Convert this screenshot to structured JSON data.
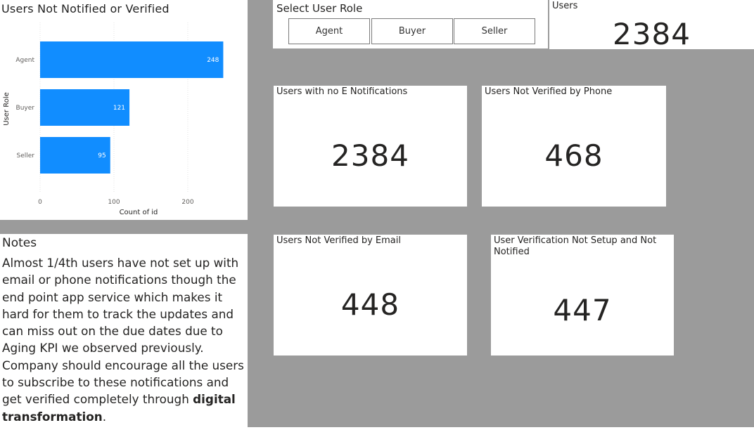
{
  "chart": {
    "title": "Users Not Notified or Verified"
  },
  "chart_data": {
    "type": "bar",
    "orientation": "horizontal",
    "categories": [
      "Agent",
      "Buyer",
      "Seller"
    ],
    "values": [
      248,
      121,
      95
    ],
    "xlabel": "Count of id",
    "ylabel": "User Role",
    "x_ticks": [
      0,
      100,
      200
    ],
    "xlim": [
      0,
      260
    ],
    "grid": true,
    "bar_color": "#118dff"
  },
  "slicer": {
    "title": "Select User Role",
    "options": [
      "Agent",
      "Buyer",
      "Seller"
    ]
  },
  "kpis": {
    "users": {
      "label": "Users",
      "value": "2384"
    },
    "no_e_notifications": {
      "label": "Users with no E Notifications",
      "value": "2384"
    },
    "not_verified_phone": {
      "label": "Users Not Verified by Phone",
      "value": "468"
    },
    "not_verified_email": {
      "label": "Users Not Verified by Email",
      "value": "448"
    },
    "not_setup_not_notified": {
      "label": "User Verification Not Setup and Not Notified",
      "value": "447"
    }
  },
  "notes": {
    "title": "Notes",
    "paragraph1": "Almost 1/4th users have not set up with email or phone notifications though the end point app service which makes it hard for them to track the updates and can miss out on the due dates due to Aging KPI we observed previously.",
    "paragraph2_prefix": "Company should encourage all the users to subscribe to these notifications and get verified completely through ",
    "paragraph2_bold": "digital transformation",
    "paragraph2_suffix": "."
  }
}
